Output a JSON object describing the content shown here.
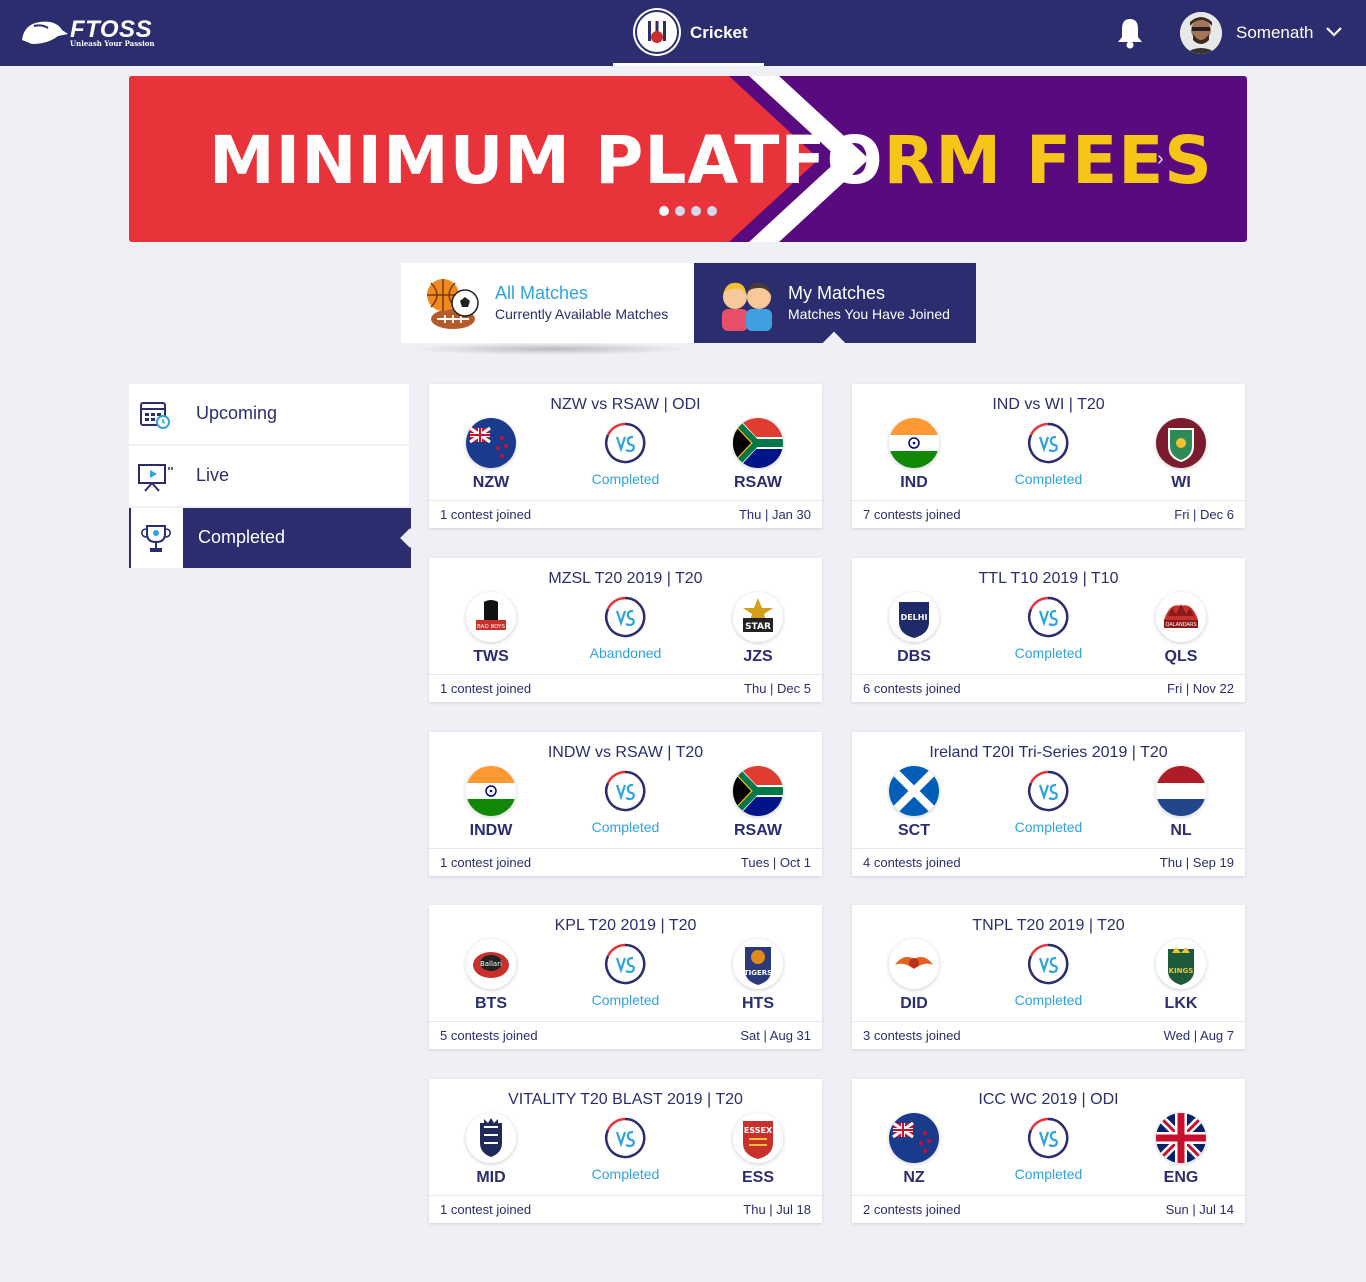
{
  "header": {
    "logo_text": "FTOSS",
    "logo_tagline": "Unleash Your Passion",
    "sport_tab": "Cricket",
    "username": "Somenath"
  },
  "banner": {
    "text_white": "MINIMUM PLATF",
    "text_mid": "O",
    "text_yellow": "RM FEES",
    "slide_count": 4,
    "active_slide": 1
  },
  "match_tabs": {
    "all": {
      "title": "All Matches",
      "subtitle": "Currently Available Matches"
    },
    "my": {
      "title": "My Matches",
      "subtitle": "Matches You Have Joined"
    }
  },
  "side_menu": {
    "items": [
      {
        "label": "Upcoming"
      },
      {
        "label": "Live"
      },
      {
        "label": "Completed"
      }
    ]
  },
  "matches": [
    {
      "title": "NZW vs RSAW | ODI",
      "team1": "NZW",
      "team2": "RSAW",
      "status": "Completed",
      "joined": "1 contest joined",
      "date": "Thu | Jan 30"
    },
    {
      "title": "IND vs WI | T20",
      "team1": "IND",
      "team2": "WI",
      "status": "Completed",
      "joined": "7 contests joined",
      "date": "Fri | Dec 6"
    },
    {
      "title": "MZSL T20 2019 | T20",
      "team1": "TWS",
      "team2": "JZS",
      "status": "Abandoned",
      "joined": "1 contest joined",
      "date": "Thu | Dec 5"
    },
    {
      "title": "TTL T10 2019 | T10",
      "team1": "DBS",
      "team2": "QLS",
      "status": "Completed",
      "joined": "6 contests joined",
      "date": "Fri | Nov 22"
    },
    {
      "title": "INDW vs RSAW | T20",
      "team1": "INDW",
      "team2": "RSAW",
      "status": "Completed",
      "joined": "1 contest joined",
      "date": "Tues | Oct 1"
    },
    {
      "title": "Ireland T20I Tri-Series 2019 | T20",
      "team1": "SCT",
      "team2": "NL",
      "status": "Completed",
      "joined": "4 contests joined",
      "date": "Thu | Sep 19"
    },
    {
      "title": "KPL T20 2019 | T20",
      "team1": "BTS",
      "team2": "HTS",
      "status": "Completed",
      "joined": "5 contests joined",
      "date": "Sat | Aug 31"
    },
    {
      "title": "TNPL T20 2019 | T20",
      "team1": "DID",
      "team2": "LKK",
      "status": "Completed",
      "joined": "3 contests joined",
      "date": "Wed | Aug 7"
    },
    {
      "title": "VITALITY T20 BLAST 2019 | T20",
      "team1": "MID",
      "team2": "ESS",
      "status": "Completed",
      "joined": "1 contest joined",
      "date": "Thu | Jul 18"
    },
    {
      "title": "ICC WC 2019 | ODI",
      "team1": "NZ",
      "team2": "ENG",
      "status": "Completed",
      "joined": "2 contests joined",
      "date": "Sun | Jul 14"
    }
  ],
  "logo_labels": {
    "tws": "BAD BOYS",
    "jzs": "STAR",
    "dbs": "DELHI",
    "qls": "QALANDARS",
    "bts": "Ballari",
    "hts": "TIGERS",
    "lkk": "KINGS",
    "ess": "ESSEX"
  },
  "colors": {
    "primary": "#2b2d6e",
    "accent": "#2ea3dd",
    "banner_red": "#e8333a",
    "banner_purple": "#5a0a7f",
    "banner_yellow": "#f5c518"
  }
}
